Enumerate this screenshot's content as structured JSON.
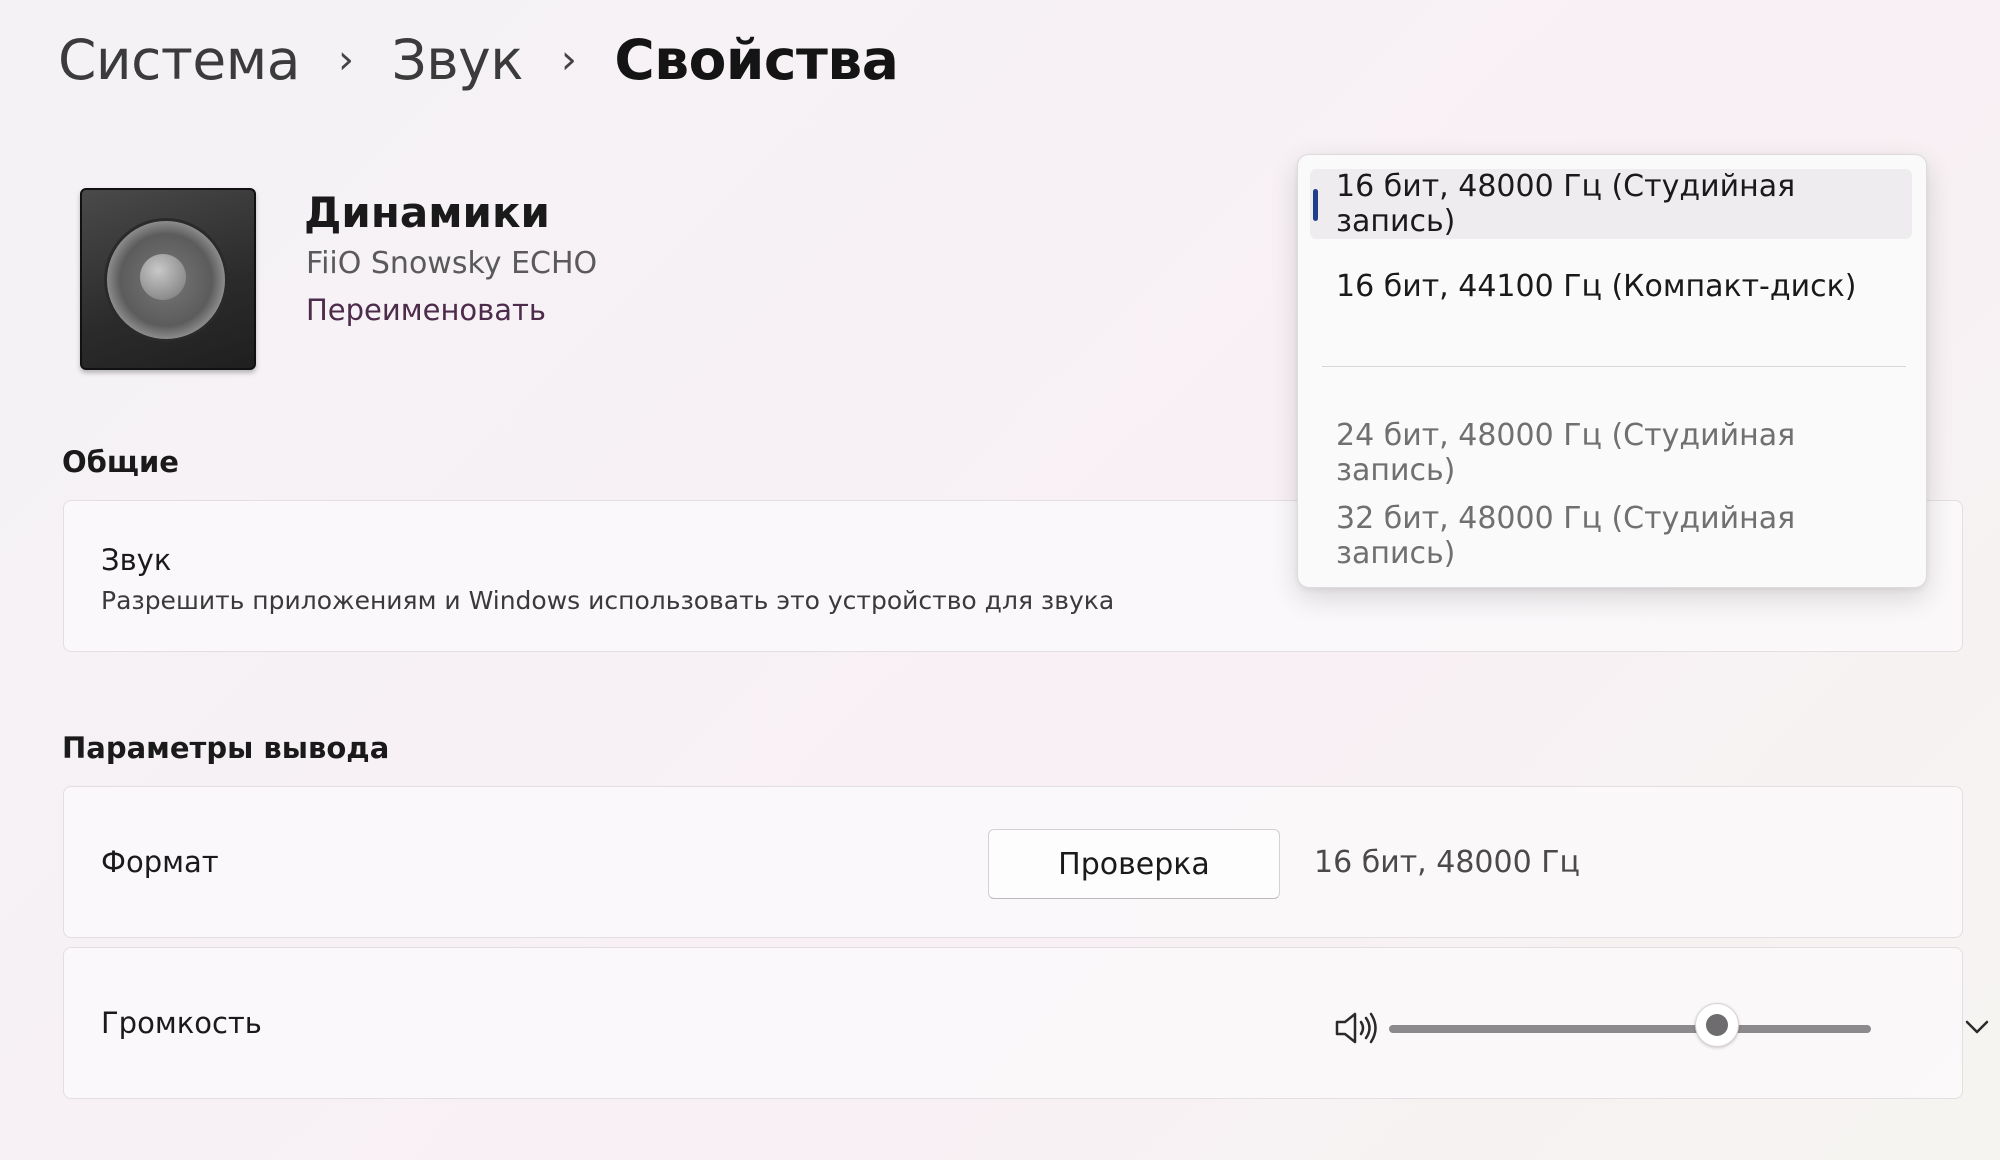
{
  "breadcrumb": {
    "items": [
      "Система",
      "Звук",
      "Свойства"
    ],
    "separator": "›"
  },
  "device": {
    "icon": "speaker-icon",
    "name": "Динамики",
    "model": "FiiO Snowsky ECHO",
    "rename_label": "Переименовать"
  },
  "general": {
    "section_title": "Общие",
    "audio": {
      "label": "Звук",
      "description": "Разрешить приложениям и Windows использовать это устройство для звука"
    }
  },
  "output": {
    "section_title": "Параметры вывода",
    "format": {
      "label": "Формат",
      "test_button": "Проверка",
      "value": "16 бит, 48000 Гц"
    },
    "volume": {
      "label": "Громкость",
      "icon": "speaker-volume-icon",
      "level": 0.68,
      "expand_icon": "chevron-down-icon"
    }
  },
  "format_dropdown": {
    "options": [
      "16 бит, 48000 Гц (Студийная запись)",
      "16 бит, 44100 Гц (Компакт-диск)",
      "24 бит, 48000 Гц (Студийная запись)",
      "32 бит, 48000 Гц (Студийная запись)"
    ],
    "selected_index": 0
  },
  "colors": {
    "accent_indicator": "#1f3f8a",
    "link": "#4d2b4b"
  }
}
